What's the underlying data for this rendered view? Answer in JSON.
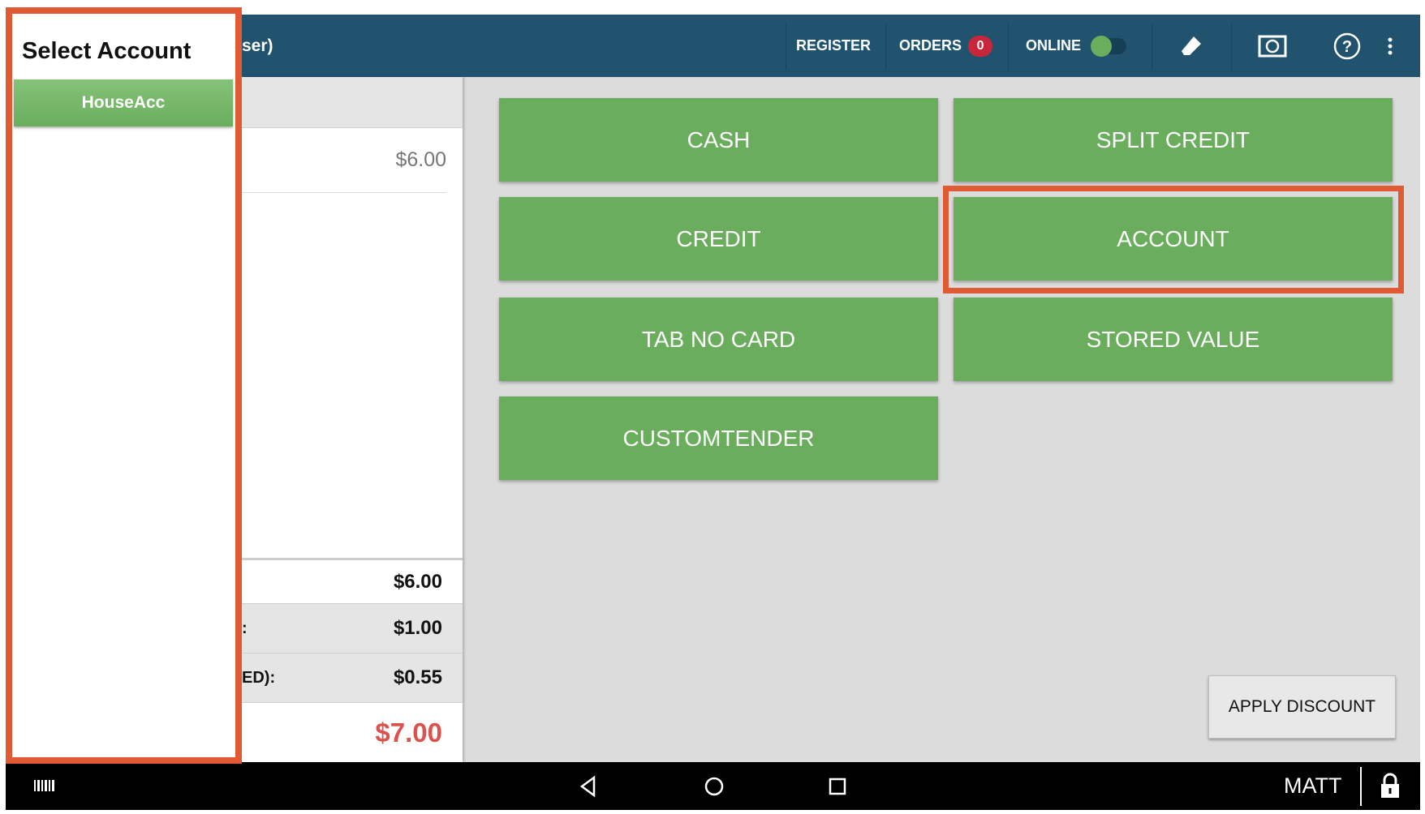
{
  "header": {
    "title_fragment": "ser)",
    "register": "REGISTER",
    "orders": "ORDERS",
    "orders_count": "0",
    "online": "ONLINE",
    "online_enabled": true,
    "icons": [
      "eraser-icon",
      "customer-display-icon",
      "help-icon",
      "more-vert-icon"
    ]
  },
  "order": {
    "item_price": "$6.00",
    "subtotal": "$6.00",
    "row2_label_fragment": ":",
    "row2_value": "$1.00",
    "row3_label_fragment": "ED):",
    "row3_value": "$0.55",
    "total": "$7.00"
  },
  "tenders": [
    "CASH",
    "SPLIT CREDIT",
    "CREDIT",
    "ACCOUNT",
    "TAB NO CARD",
    "STORED VALUE",
    "CUSTOMTENDER"
  ],
  "apply_discount": "APPLY DISCOUNT",
  "select_account": {
    "title": "Select Account",
    "accounts": [
      "HouseAcc"
    ]
  },
  "navbar": {
    "user": "MATT",
    "icons": [
      "barcode-icon",
      "back-icon",
      "home-icon",
      "recents-icon",
      "lock-icon"
    ]
  },
  "colors": {
    "header": "#21536f",
    "tender": "#6aae5d",
    "highlight": "#e05a33",
    "total": "#d9534f",
    "badge": "#c8273b"
  }
}
